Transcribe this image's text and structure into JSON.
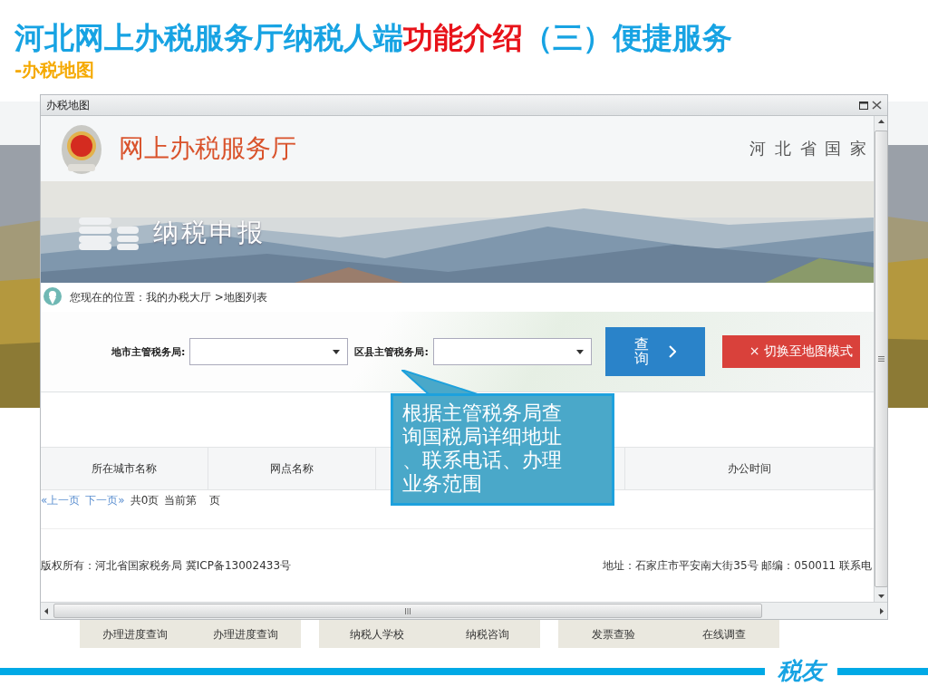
{
  "slide": {
    "title": [
      {
        "text": "河北网上办税服务厅纳税人端",
        "highlight": false
      },
      {
        "text": "功能介绍",
        "highlight": true
      },
      {
        "text": "（三）便捷服务",
        "highlight": false
      }
    ],
    "subtitle": "-办税地图"
  },
  "background_page": {
    "service_groups": [
      [
        "办理进度查询",
        "办理进度查询"
      ],
      [
        "纳税人学校",
        "纳税咨询"
      ],
      [
        "发票查验",
        "在线调查"
      ]
    ]
  },
  "window": {
    "title": "办税地图",
    "site_name": "网上办税服务厅",
    "site_region": "河 北 省 国 家",
    "banner_title": "纳税申报",
    "breadcrumb": "您现在的位置：我的办税大厅 >地图列表",
    "filters": [
      {
        "label": "地市主管税务局:"
      },
      {
        "label": "区县主管税务局:"
      }
    ],
    "query_button": "查询",
    "map_mode_button": "× 切换至地图模式",
    "table": {
      "columns": [
        {
          "label": "所在城市名称"
        },
        {
          "label": "网点名称"
        },
        {
          "label": "办公时间"
        }
      ]
    },
    "pagination": {
      "prev": "«上一页",
      "next": "下一页»",
      "total": "共0页",
      "current_prefix": "当前第",
      "current_suffix": "页"
    },
    "footer": {
      "copyright": "版权所有：河北省国家税务局 冀ICP备13002433号",
      "address": "地址：石家庄市平安南大街35号 邮编：050011 联系电"
    }
  },
  "callout": {
    "text": "根据主管税务局查询国税局详细地址、联系电话、办理业务范围"
  },
  "logo": {
    "text": "税友"
  }
}
